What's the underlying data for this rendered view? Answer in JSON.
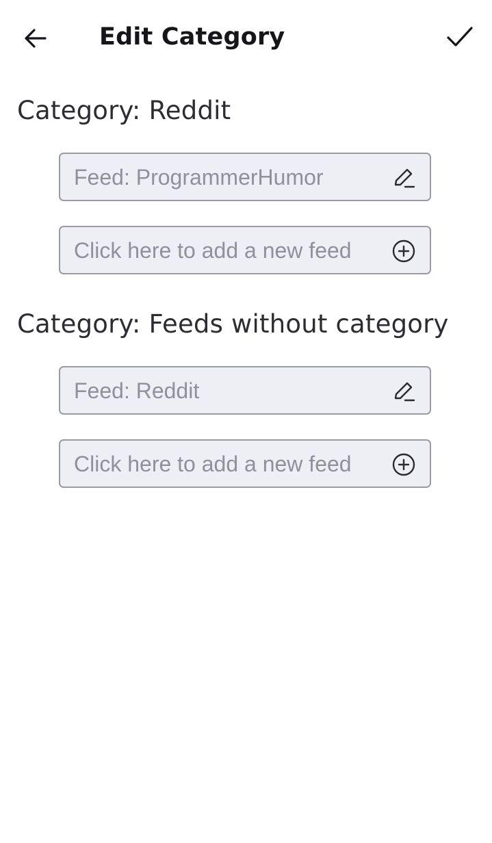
{
  "header": {
    "title": "Edit Category",
    "back_icon": "arrow-left-icon",
    "confirm_icon": "check-icon"
  },
  "categories": [
    {
      "heading": "Category: Reddit",
      "feeds": [
        {
          "label": "Feed: ProgrammerHumor",
          "icon": "pencil-icon"
        }
      ],
      "add_feed": {
        "label": "Click here to add a new feed",
        "icon": "plus-circle-icon"
      }
    },
    {
      "heading": "Category: Feeds without category",
      "feeds": [
        {
          "label": "Feed: Reddit",
          "icon": "pencil-icon"
        }
      ],
      "add_feed": {
        "label": "Click here to add a new feed",
        "icon": "plus-circle-icon"
      }
    }
  ],
  "colors": {
    "field_background": "#eeeff4",
    "field_border": "#9a9aa4",
    "placeholder_text": "#8f909c",
    "heading_text": "#2c2c33"
  }
}
